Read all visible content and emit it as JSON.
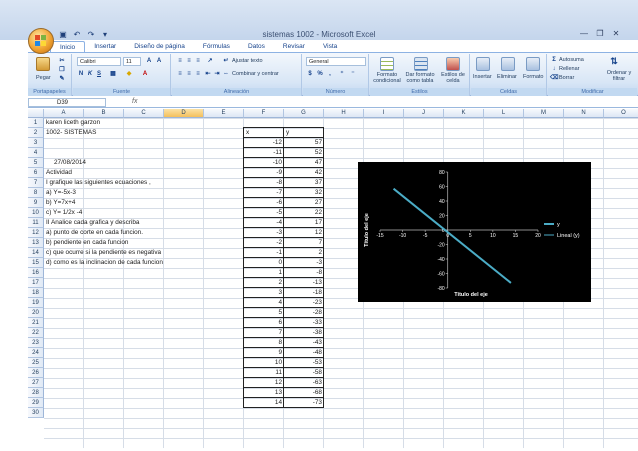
{
  "window": {
    "title": "sistemas 1002 - Microsoft Excel"
  },
  "tabs": [
    "Inicio",
    "Insertar",
    "Diseño de página",
    "Fórmulas",
    "Datos",
    "Revisar",
    "Vista"
  ],
  "ribbon": {
    "groups": {
      "clipboard": "Portapapeles",
      "font": "Fuente",
      "alignment": "Alineación",
      "number": "Número",
      "styles": "Estilos",
      "cells": "Celdas",
      "modify": "Modificar"
    },
    "paste_label": "Pegar",
    "font_name": "Calibri",
    "font_size": "11",
    "wrap_text": "Ajustar texto",
    "merge_center": "Combinar y centrar",
    "number_format": "General",
    "conditional_format": "Formato condicional",
    "format_table": "Dar formato como tabla",
    "cell_styles": "Estilos de celda",
    "insert": "Insertar",
    "delete": "Eliminar",
    "format": "Formato",
    "autosum": "Autosuma",
    "fill": "Rellenar",
    "clear": "Borrar",
    "sort_filter": "Ordenar y filtrar"
  },
  "formula_bar": {
    "name_box": "D39",
    "fx": "fx",
    "formula": ""
  },
  "columns": [
    "A",
    "B",
    "C",
    "D",
    "E",
    "F",
    "G",
    "H",
    "I",
    "J",
    "K",
    "L",
    "M",
    "N",
    "O"
  ],
  "rows": [
    "1",
    "2",
    "3",
    "4",
    "5",
    "6",
    "7",
    "8",
    "9",
    "10",
    "11",
    "12",
    "13",
    "14",
    "15",
    "16",
    "17",
    "18",
    "19",
    "20",
    "21",
    "22",
    "23",
    "24",
    "25",
    "26",
    "27",
    "28",
    "29",
    "30"
  ],
  "text_cells": [
    "karen liceth garzon",
    "1002- SISTEMAS",
    "",
    "",
    "27/08/2014",
    "Actividad",
    "I grafique las siguientes ecuaciones ,",
    "a) Y=-5x-3",
    "b) Y=7x+4",
    "c) Y= 1/2x -4",
    "II Analice cada grafica y describa",
    "a) punto de corte en cada funcion.",
    "b) pendiente en cada funcion",
    "c) que ocurre si la pendiente es negativa",
    "d) como es la inclinacion de cada funcion"
  ],
  "table": {
    "header_x": "x",
    "header_y": "y",
    "x": [
      "-12",
      "-11",
      "-10",
      "-9",
      "-8",
      "-7",
      "-6",
      "-5",
      "-4",
      "-3",
      "-2",
      "-1",
      "0",
      "1",
      "2",
      "3",
      "4",
      "5",
      "6",
      "7",
      "8",
      "9",
      "10",
      "11",
      "12",
      "13",
      "14"
    ],
    "y": [
      "57",
      "52",
      "47",
      "42",
      "37",
      "32",
      "27",
      "22",
      "17",
      "12",
      "7",
      "2",
      "-3",
      "-8",
      "-13",
      "-18",
      "-23",
      "-28",
      "-33",
      "-38",
      "-43",
      "-48",
      "-53",
      "-58",
      "-63",
      "-68",
      "-73"
    ]
  },
  "chart_data": {
    "type": "line",
    "title": "",
    "xlabel": "Título del eje",
    "ylabel": "Título del eje",
    "xlim": [
      -15,
      20
    ],
    "ylim": [
      -80,
      80
    ],
    "xticks": [
      "-15",
      "-10",
      "-5",
      "0",
      "5",
      "10",
      "15",
      "20"
    ],
    "yticks": [
      "80",
      "60",
      "40",
      "20",
      "0",
      "-20",
      "-40",
      "-60",
      "-80"
    ],
    "series": [
      {
        "name": "y",
        "x": [
          -12,
          14
        ],
        "y": [
          57,
          -73
        ]
      }
    ],
    "legend": [
      "y",
      "Lineal (y)"
    ],
    "legend_position": "right",
    "background": "#000000",
    "line_color": "#4bacc6",
    "text_color": "#ffffff"
  }
}
